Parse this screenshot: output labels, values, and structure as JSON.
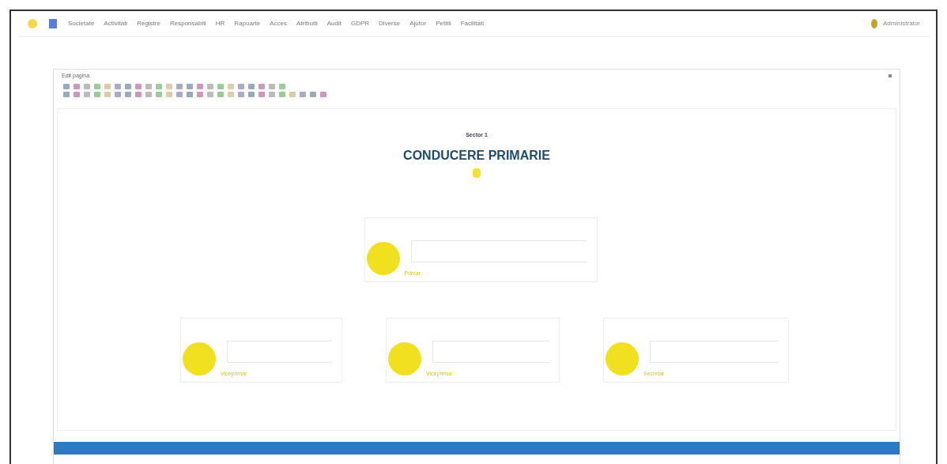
{
  "nav": {
    "items": [
      "Societate",
      "Activitati",
      "Registre",
      "Responsabili",
      "HR",
      "Rapoarte",
      "Acces",
      "Atributii",
      "Audit",
      "GDPR",
      "Diverse",
      "Ajutor",
      "Petitii",
      "Facilitati"
    ],
    "user": "Administrator"
  },
  "editor": {
    "title": "Edit pagina"
  },
  "page": {
    "subtitle": "Sector 1",
    "title": "CONDUCERE PRIMARIE"
  },
  "org_chart": {
    "top": {
      "label": "Primar"
    },
    "bottom": [
      {
        "label": "Viceprimar"
      },
      {
        "label": "Viceprimar"
      },
      {
        "label": "Secretar"
      }
    ]
  }
}
